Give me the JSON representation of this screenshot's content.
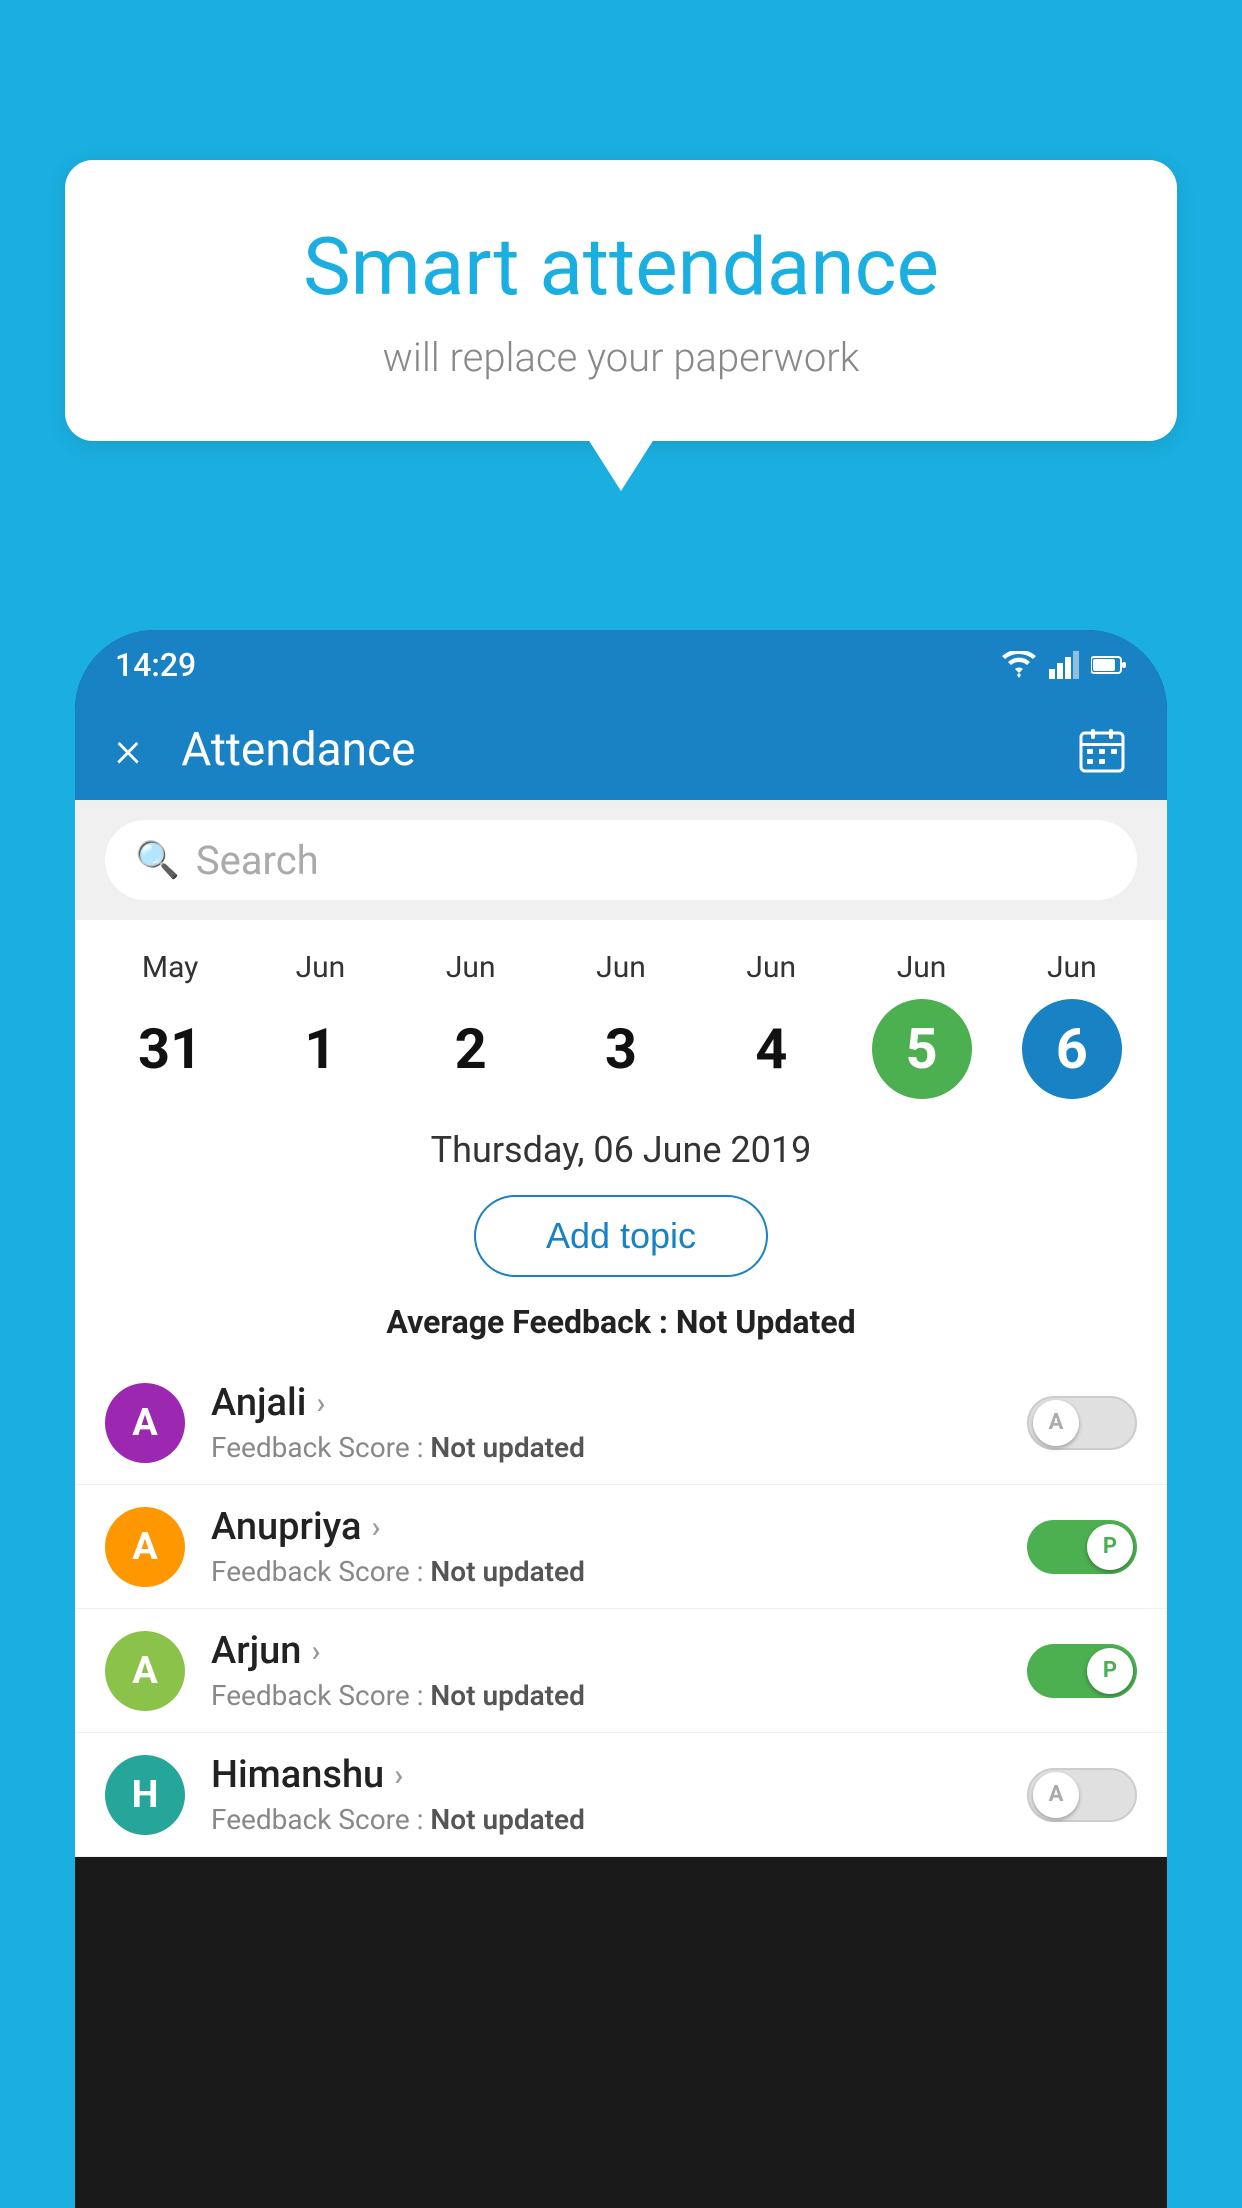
{
  "background_color": "#1AAFE0",
  "bubble": {
    "title": "Smart attendance",
    "subtitle": "will replace your paperwork"
  },
  "status_bar": {
    "time": "14:29",
    "icons": [
      "wifi",
      "signal",
      "battery"
    ]
  },
  "app_bar": {
    "title": "Attendance",
    "close_label": "×"
  },
  "search": {
    "placeholder": "Search"
  },
  "calendar": {
    "days": [
      {
        "month": "May",
        "date": "31",
        "style": "normal"
      },
      {
        "month": "Jun",
        "date": "1",
        "style": "normal"
      },
      {
        "month": "Jun",
        "date": "2",
        "style": "normal"
      },
      {
        "month": "Jun",
        "date": "3",
        "style": "normal"
      },
      {
        "month": "Jun",
        "date": "4",
        "style": "normal"
      },
      {
        "month": "Jun",
        "date": "5",
        "style": "green"
      },
      {
        "month": "Jun",
        "date": "6",
        "style": "blue"
      }
    ]
  },
  "selected_date": "Thursday, 06 June 2019",
  "add_topic_label": "Add topic",
  "avg_feedback_label": "Average Feedback :",
  "avg_feedback_value": "Not Updated",
  "students": [
    {
      "name": "Anjali",
      "avatar_letter": "A",
      "avatar_color": "purple",
      "feedback_label": "Feedback Score :",
      "feedback_value": "Not updated",
      "toggle": "off",
      "toggle_label": "A"
    },
    {
      "name": "Anupriya",
      "avatar_letter": "A",
      "avatar_color": "orange",
      "feedback_label": "Feedback Score :",
      "feedback_value": "Not updated",
      "toggle": "on",
      "toggle_label": "P"
    },
    {
      "name": "Arjun",
      "avatar_letter": "A",
      "avatar_color": "green-light",
      "feedback_label": "Feedback Score :",
      "feedback_value": "Not updated",
      "toggle": "on",
      "toggle_label": "P"
    },
    {
      "name": "Himanshu",
      "avatar_letter": "H",
      "avatar_color": "teal",
      "feedback_label": "Feedback Score :",
      "feedback_value": "Not updated",
      "toggle": "off",
      "toggle_label": "A"
    }
  ]
}
